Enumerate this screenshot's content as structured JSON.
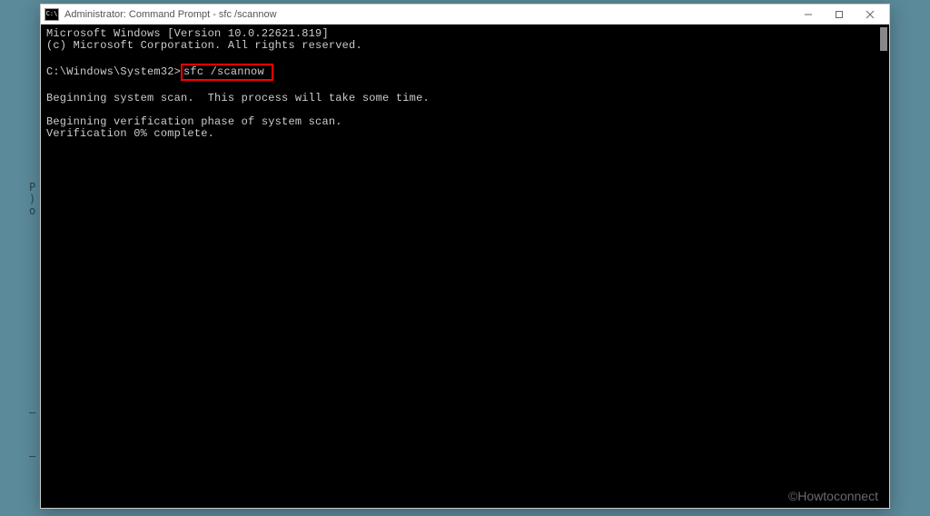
{
  "window": {
    "title": "Administrator: Command Prompt - sfc  /scannow",
    "icon_label": "C:\\"
  },
  "console": {
    "line1": "Microsoft Windows [Version 10.0.22621.819]",
    "line2": "(c) Microsoft Corporation. All rights reserved.",
    "blank1": "",
    "prompt": "C:\\Windows\\System32>",
    "command": "sfc /scannow",
    "blank2": "",
    "line3": "Beginning system scan.  This process will take some time.",
    "blank3": "",
    "line4": "Beginning verification phase of system scan.",
    "line5": "Verification 0% complete."
  },
  "watermark": "©Howtoconnect"
}
